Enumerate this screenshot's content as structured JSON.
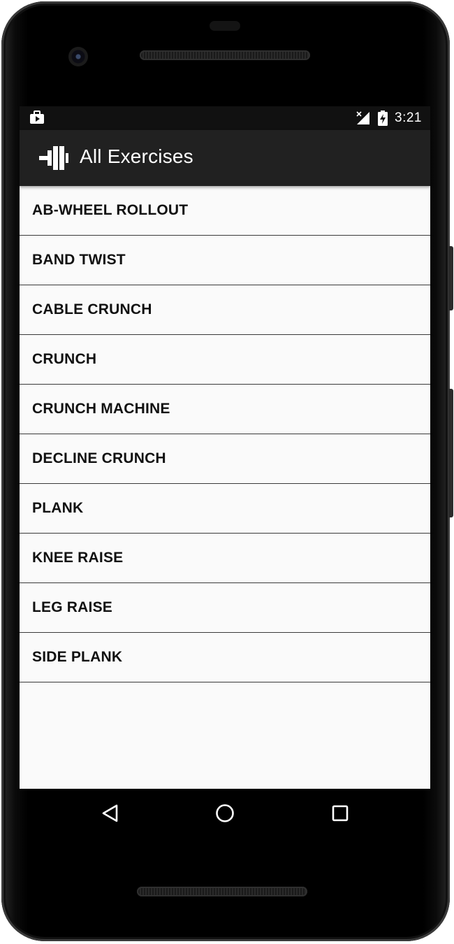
{
  "status_bar": {
    "time": "3:21",
    "left_icon": "work-profile-icon",
    "signal_icon": "signal-off-icon",
    "battery_icon": "battery-charging-icon"
  },
  "app_bar": {
    "title": "All Exercises",
    "logo_icon": "dumbbell-icon",
    "background": "#212121"
  },
  "exercises": [
    "AB-WHEEL ROLLOUT",
    "BAND TWIST",
    "CABLE CRUNCH",
    "CRUNCH",
    "CRUNCH MACHINE",
    "DECLINE CRUNCH",
    "PLANK",
    "KNEE RAISE",
    "LEG RAISE",
    "SIDE PLANK"
  ],
  "nav_bar": {
    "back_icon": "back-triangle-icon",
    "home_icon": "home-circle-icon",
    "recents_icon": "recents-square-icon"
  },
  "colors": {
    "list_background": "#fafafa",
    "divider": "#3a3a3a",
    "text": "#111111"
  }
}
